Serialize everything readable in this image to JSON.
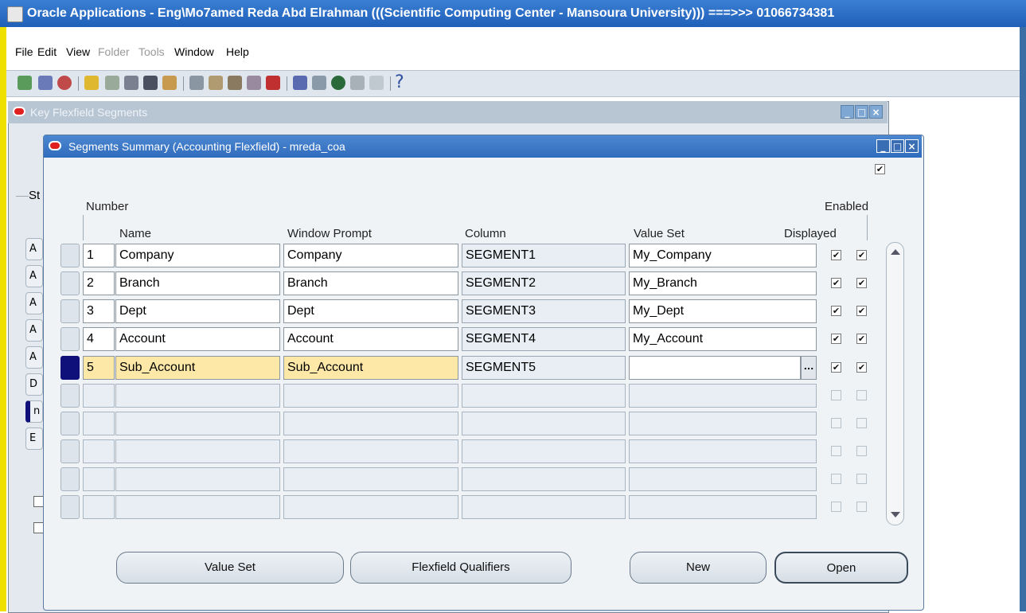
{
  "title_bar": {
    "title": "Oracle Applications - Eng\\Mo7amed Reda Abd Elrahman (((Scientific Computing Center - Mansoura University))) ===>>> 01066734381"
  },
  "menu": {
    "items": [
      {
        "label": "File",
        "enabled": true
      },
      {
        "label": "Edit",
        "enabled": true
      },
      {
        "label": "View",
        "enabled": true
      },
      {
        "label": "Folder",
        "enabled": false
      },
      {
        "label": "Tools",
        "enabled": false
      },
      {
        "label": "Window",
        "enabled": true
      },
      {
        "label": "Help",
        "enabled": true
      }
    ]
  },
  "toolbar": {
    "icons": [
      "new-record-icon",
      "find-icon",
      "navigator-icon",
      "save-icon",
      "next-step-icon",
      "switch-responsibility-icon",
      "print-icon",
      "close-form-icon",
      "cut-icon",
      "copy-icon",
      "paste-icon",
      "clear-record-icon",
      "delete-record-icon",
      "edit-field-icon",
      "zoom-icon",
      "translations-icon",
      "attachments-icon",
      "folder-tools-icon",
      "help-icon"
    ],
    "help_glyph": "?"
  },
  "back_window": {
    "title": "Key Flexfield Segments",
    "section_label": "St",
    "row_labels": [
      "A",
      "A",
      "A",
      "A",
      "A",
      "D",
      "n",
      "E"
    ]
  },
  "segments_window": {
    "title": "Segments Summary (Accounting Flexfield) - mreda_coa",
    "headers": {
      "number": "Number",
      "name": "Name",
      "window_prompt": "Window Prompt",
      "column": "Column",
      "value_set": "Value Set",
      "enabled": "Enabled",
      "displayed": "Displayed"
    },
    "lov_glyph": "...",
    "rows": [
      {
        "number": "1",
        "name": "Company",
        "prompt": "Company",
        "column": "SEGMENT1",
        "value_set": "My_Company",
        "displayed": true,
        "enabled": true
      },
      {
        "number": "2",
        "name": "Branch",
        "prompt": "Branch",
        "column": "SEGMENT2",
        "value_set": "My_Branch",
        "displayed": true,
        "enabled": true
      },
      {
        "number": "3",
        "name": "Dept",
        "prompt": "Dept",
        "column": "SEGMENT3",
        "value_set": "My_Dept",
        "displayed": true,
        "enabled": true
      },
      {
        "number": "4",
        "name": "Account",
        "prompt": "Account",
        "column": "SEGMENT4",
        "value_set": "My_Account",
        "displayed": true,
        "enabled": true
      },
      {
        "number": "5",
        "name": "Sub_Account",
        "prompt": "Sub_Account",
        "column": "SEGMENT5",
        "value_set": "",
        "displayed": true,
        "enabled": true
      }
    ],
    "empty_rows": 5,
    "buttons": {
      "value_set": "Value Set",
      "flexfield_qualifiers": "Flexfield Qualifiers",
      "new": "New",
      "open": "Open"
    }
  },
  "colors": {
    "title_bar": "#2f6cbd",
    "current_row": "#fde8a8",
    "row_indicator": "#10107a",
    "frame_left": "#f0e000"
  }
}
